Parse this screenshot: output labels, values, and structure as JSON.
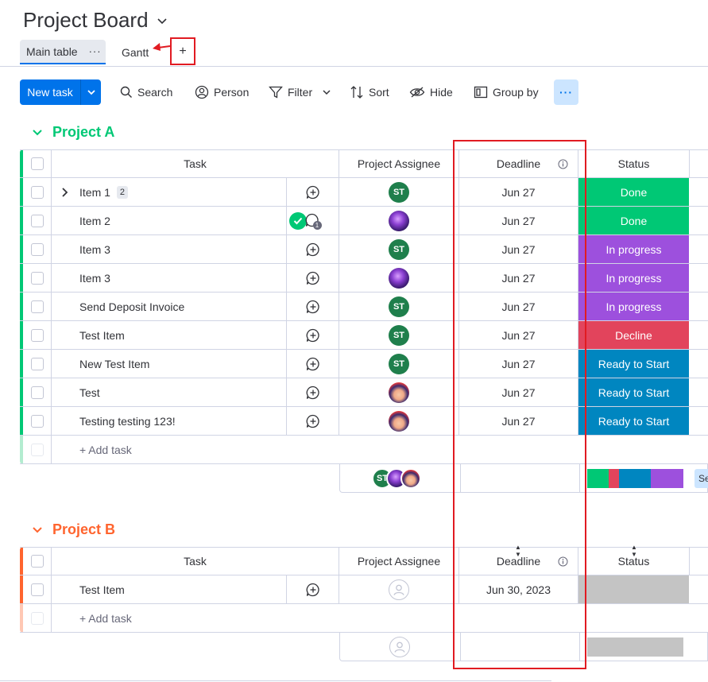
{
  "board": {
    "title": "Project Board"
  },
  "views": {
    "tabs": [
      {
        "label": "Main table",
        "more": "···"
      },
      {
        "label": "Gantt"
      }
    ],
    "add_label": "+"
  },
  "toolbar": {
    "new_task": "New task",
    "search": "Search",
    "person": "Person",
    "filter": "Filter",
    "sort": "Sort",
    "hide": "Hide",
    "group_by": "Group by",
    "more": "···"
  },
  "columns": {
    "task": "Task",
    "assignee": "Project Assignee",
    "deadline": "Deadline",
    "status": "Status"
  },
  "colors": {
    "done": "#00c875",
    "in_progress": "#9d50dd",
    "decline": "#e2445c",
    "ready": "#0086c0",
    "empty": "#c4c4c4",
    "group_a": "#00c875",
    "group_b": "#ff642e",
    "accent": "#0073ea"
  },
  "groups": [
    {
      "name": "Project A",
      "add_task": "+ Add task",
      "rows": [
        {
          "task": "Item 1",
          "subitems": "2",
          "assignee": "ST",
          "deadline": "Jun 27",
          "status": "Done"
        },
        {
          "task": "Item 2",
          "updates": "1",
          "assignee": "photo1",
          "deadline": "Jun 27",
          "status": "Done"
        },
        {
          "task": "Item 3",
          "assignee": "ST",
          "deadline": "Jun 27",
          "status": "In progress"
        },
        {
          "task": "Item 3",
          "assignee": "photo1",
          "deadline": "Jun 27",
          "status": "In progress"
        },
        {
          "task": "Send Deposit Invoice",
          "assignee": "ST",
          "deadline": "Jun 27",
          "status": "In progress"
        },
        {
          "task": "Test Item",
          "assignee": "ST",
          "deadline": "Jun 27",
          "status": "Decline"
        },
        {
          "task": "New Test Item",
          "assignee": "ST",
          "deadline": "Jun 27",
          "status": "Ready to Start"
        },
        {
          "task": "Test",
          "assignee": "photo2",
          "deadline": "Jun 27",
          "status": "Ready to Start"
        },
        {
          "task": "Testing testing 123!",
          "assignee": "photo2",
          "deadline": "Jun 27",
          "status": "Ready to Start"
        }
      ],
      "summary": {
        "avatar_initials": "ST",
        "status_fraction": {
          "Done": 0.22,
          "Decline": 0.11,
          "Ready to Start": 0.33,
          "In progress": 0.34
        },
        "next_col_label": "Se"
      }
    },
    {
      "name": "Project B",
      "add_task": "+ Add task",
      "rows": [
        {
          "task": "Test Item",
          "assignee": "",
          "deadline": "Jun 30, 2023",
          "status": ""
        }
      ]
    }
  ]
}
